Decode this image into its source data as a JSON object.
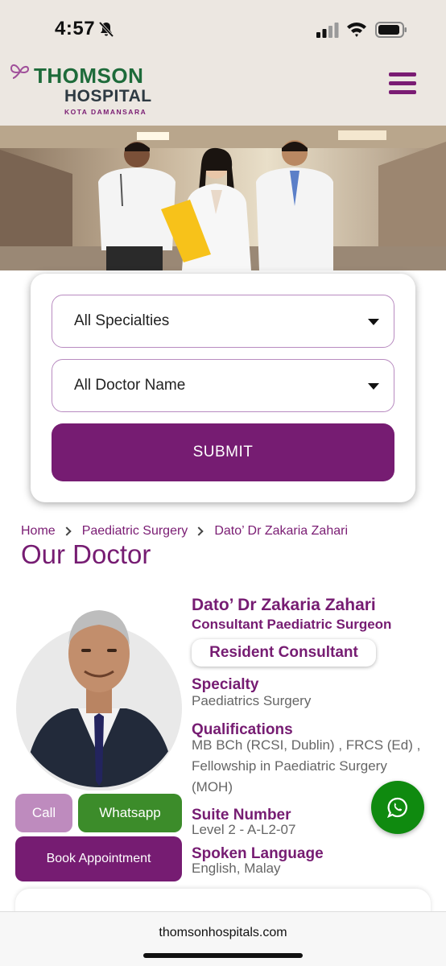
{
  "status_bar": {
    "time": "4:57"
  },
  "header": {
    "brand_name": "THOMSON",
    "brand_sub": "HOSPITAL",
    "brand_location": "KOTA DAMANSARA"
  },
  "search": {
    "specialty_value": "All Specialties",
    "doctor_value": "All Doctor Name",
    "submit_label": "SUBMIT"
  },
  "breadcrumb": [
    "Home",
    "Paediatric Surgery",
    "Dato’ Dr Zakaria Zahari"
  ],
  "page_title": "Our Doctor",
  "doctor": {
    "name": "Dato’ Dr Zakaria Zahari",
    "title": "Consultant Paediatric Surgeon",
    "badge": "Resident Consultant",
    "specialty_label": "Specialty",
    "specialty_value": "Paediatrics Surgery",
    "qualifications_label": "Qualifications",
    "qualifications_value": "MB BCh (RCSI, Dublin) , FRCS (Ed) , Fellowship in Paediatric Surgery (MOH)",
    "suite_label": "Suite Number",
    "suite_value": "Level 2 - A-L2-07",
    "language_label": "Spoken Language",
    "language_value": "English, Malay"
  },
  "actions": {
    "call": "Call",
    "whatsapp": "Whatsapp",
    "book": "Book Appointment"
  },
  "browser": {
    "url": "thomsonhospitals.com"
  },
  "colors": {
    "brand_purple": "#761C72",
    "brand_green": "#1E6B3A",
    "whatsapp_green": "#0F8A0F",
    "header_bg": "#ECE7E1"
  }
}
